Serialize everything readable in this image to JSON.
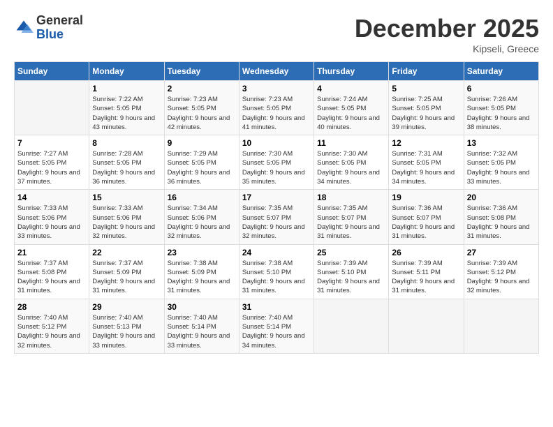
{
  "logo": {
    "general": "General",
    "blue": "Blue"
  },
  "title": {
    "month_year": "December 2025",
    "location": "Kipseli, Greece"
  },
  "headers": [
    "Sunday",
    "Monday",
    "Tuesday",
    "Wednesday",
    "Thursday",
    "Friday",
    "Saturday"
  ],
  "weeks": [
    [
      {
        "day": "",
        "sunrise": "",
        "sunset": "",
        "daylight": ""
      },
      {
        "day": "1",
        "sunrise": "Sunrise: 7:22 AM",
        "sunset": "Sunset: 5:05 PM",
        "daylight": "Daylight: 9 hours and 43 minutes."
      },
      {
        "day": "2",
        "sunrise": "Sunrise: 7:23 AM",
        "sunset": "Sunset: 5:05 PM",
        "daylight": "Daylight: 9 hours and 42 minutes."
      },
      {
        "day": "3",
        "sunrise": "Sunrise: 7:23 AM",
        "sunset": "Sunset: 5:05 PM",
        "daylight": "Daylight: 9 hours and 41 minutes."
      },
      {
        "day": "4",
        "sunrise": "Sunrise: 7:24 AM",
        "sunset": "Sunset: 5:05 PM",
        "daylight": "Daylight: 9 hours and 40 minutes."
      },
      {
        "day": "5",
        "sunrise": "Sunrise: 7:25 AM",
        "sunset": "Sunset: 5:05 PM",
        "daylight": "Daylight: 9 hours and 39 minutes."
      },
      {
        "day": "6",
        "sunrise": "Sunrise: 7:26 AM",
        "sunset": "Sunset: 5:05 PM",
        "daylight": "Daylight: 9 hours and 38 minutes."
      }
    ],
    [
      {
        "day": "7",
        "sunrise": "Sunrise: 7:27 AM",
        "sunset": "Sunset: 5:05 PM",
        "daylight": "Daylight: 9 hours and 37 minutes."
      },
      {
        "day": "8",
        "sunrise": "Sunrise: 7:28 AM",
        "sunset": "Sunset: 5:05 PM",
        "daylight": "Daylight: 9 hours and 36 minutes."
      },
      {
        "day": "9",
        "sunrise": "Sunrise: 7:29 AM",
        "sunset": "Sunset: 5:05 PM",
        "daylight": "Daylight: 9 hours and 36 minutes."
      },
      {
        "day": "10",
        "sunrise": "Sunrise: 7:30 AM",
        "sunset": "Sunset: 5:05 PM",
        "daylight": "Daylight: 9 hours and 35 minutes."
      },
      {
        "day": "11",
        "sunrise": "Sunrise: 7:30 AM",
        "sunset": "Sunset: 5:05 PM",
        "daylight": "Daylight: 9 hours and 34 minutes."
      },
      {
        "day": "12",
        "sunrise": "Sunrise: 7:31 AM",
        "sunset": "Sunset: 5:05 PM",
        "daylight": "Daylight: 9 hours and 34 minutes."
      },
      {
        "day": "13",
        "sunrise": "Sunrise: 7:32 AM",
        "sunset": "Sunset: 5:05 PM",
        "daylight": "Daylight: 9 hours and 33 minutes."
      }
    ],
    [
      {
        "day": "14",
        "sunrise": "Sunrise: 7:33 AM",
        "sunset": "Sunset: 5:06 PM",
        "daylight": "Daylight: 9 hours and 33 minutes."
      },
      {
        "day": "15",
        "sunrise": "Sunrise: 7:33 AM",
        "sunset": "Sunset: 5:06 PM",
        "daylight": "Daylight: 9 hours and 32 minutes."
      },
      {
        "day": "16",
        "sunrise": "Sunrise: 7:34 AM",
        "sunset": "Sunset: 5:06 PM",
        "daylight": "Daylight: 9 hours and 32 minutes."
      },
      {
        "day": "17",
        "sunrise": "Sunrise: 7:35 AM",
        "sunset": "Sunset: 5:07 PM",
        "daylight": "Daylight: 9 hours and 32 minutes."
      },
      {
        "day": "18",
        "sunrise": "Sunrise: 7:35 AM",
        "sunset": "Sunset: 5:07 PM",
        "daylight": "Daylight: 9 hours and 31 minutes."
      },
      {
        "day": "19",
        "sunrise": "Sunrise: 7:36 AM",
        "sunset": "Sunset: 5:07 PM",
        "daylight": "Daylight: 9 hours and 31 minutes."
      },
      {
        "day": "20",
        "sunrise": "Sunrise: 7:36 AM",
        "sunset": "Sunset: 5:08 PM",
        "daylight": "Daylight: 9 hours and 31 minutes."
      }
    ],
    [
      {
        "day": "21",
        "sunrise": "Sunrise: 7:37 AM",
        "sunset": "Sunset: 5:08 PM",
        "daylight": "Daylight: 9 hours and 31 minutes."
      },
      {
        "day": "22",
        "sunrise": "Sunrise: 7:37 AM",
        "sunset": "Sunset: 5:09 PM",
        "daylight": "Daylight: 9 hours and 31 minutes."
      },
      {
        "day": "23",
        "sunrise": "Sunrise: 7:38 AM",
        "sunset": "Sunset: 5:09 PM",
        "daylight": "Daylight: 9 hours and 31 minutes."
      },
      {
        "day": "24",
        "sunrise": "Sunrise: 7:38 AM",
        "sunset": "Sunset: 5:10 PM",
        "daylight": "Daylight: 9 hours and 31 minutes."
      },
      {
        "day": "25",
        "sunrise": "Sunrise: 7:39 AM",
        "sunset": "Sunset: 5:10 PM",
        "daylight": "Daylight: 9 hours and 31 minutes."
      },
      {
        "day": "26",
        "sunrise": "Sunrise: 7:39 AM",
        "sunset": "Sunset: 5:11 PM",
        "daylight": "Daylight: 9 hours and 31 minutes."
      },
      {
        "day": "27",
        "sunrise": "Sunrise: 7:39 AM",
        "sunset": "Sunset: 5:12 PM",
        "daylight": "Daylight: 9 hours and 32 minutes."
      }
    ],
    [
      {
        "day": "28",
        "sunrise": "Sunrise: 7:40 AM",
        "sunset": "Sunset: 5:12 PM",
        "daylight": "Daylight: 9 hours and 32 minutes."
      },
      {
        "day": "29",
        "sunrise": "Sunrise: 7:40 AM",
        "sunset": "Sunset: 5:13 PM",
        "daylight": "Daylight: 9 hours and 33 minutes."
      },
      {
        "day": "30",
        "sunrise": "Sunrise: 7:40 AM",
        "sunset": "Sunset: 5:14 PM",
        "daylight": "Daylight: 9 hours and 33 minutes."
      },
      {
        "day": "31",
        "sunrise": "Sunrise: 7:40 AM",
        "sunset": "Sunset: 5:14 PM",
        "daylight": "Daylight: 9 hours and 34 minutes."
      },
      {
        "day": "",
        "sunrise": "",
        "sunset": "",
        "daylight": ""
      },
      {
        "day": "",
        "sunrise": "",
        "sunset": "",
        "daylight": ""
      },
      {
        "day": "",
        "sunrise": "",
        "sunset": "",
        "daylight": ""
      }
    ]
  ]
}
